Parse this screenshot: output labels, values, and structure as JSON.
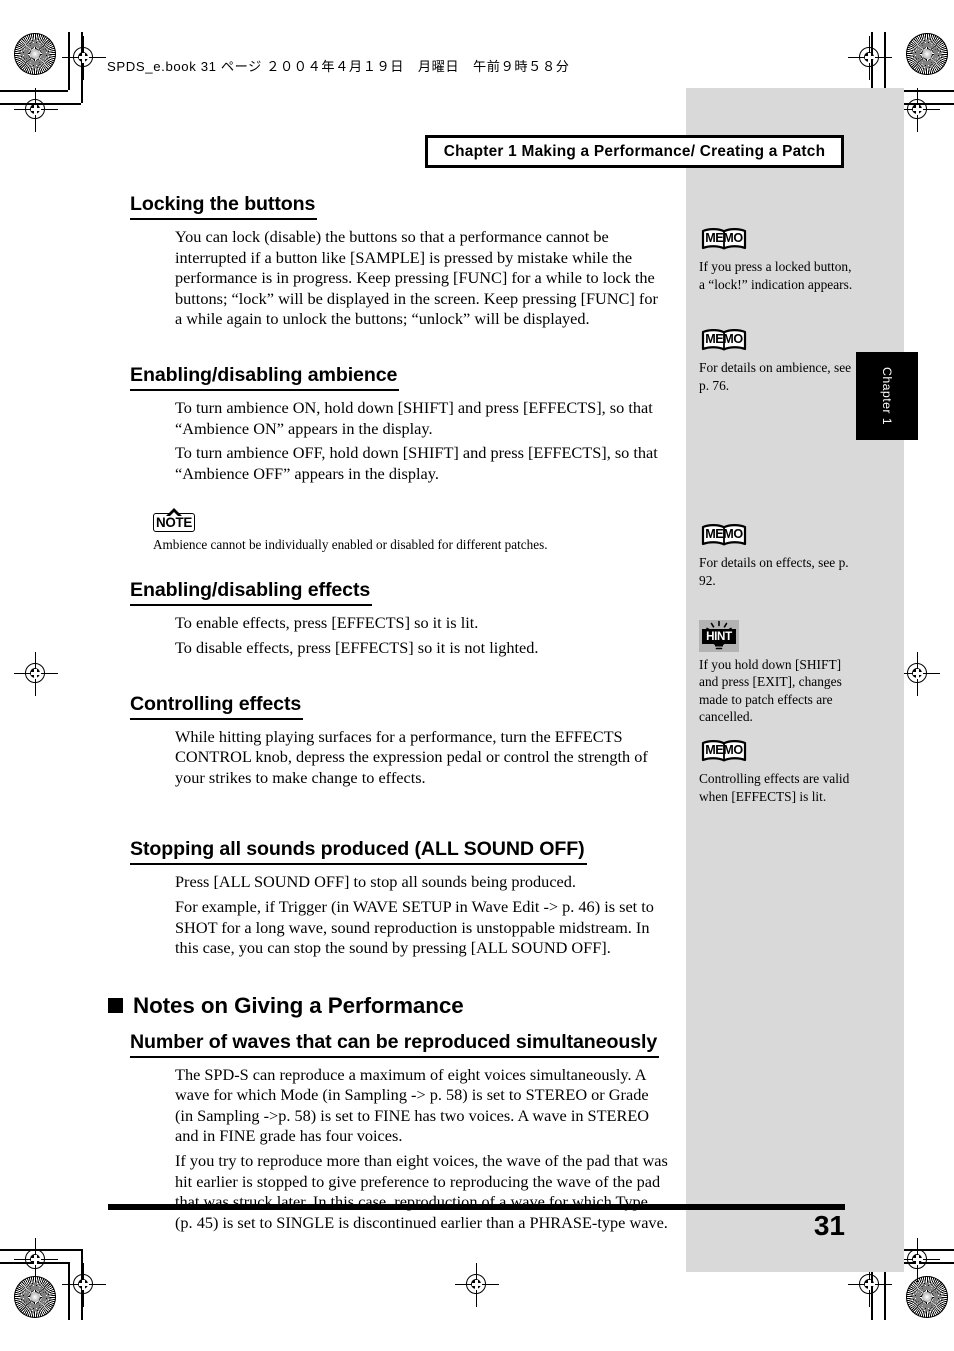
{
  "print_marks": {
    "slug": "SPDS_e.book  31 ページ  ２００４年４月１９日　月曜日　午前９時５８分"
  },
  "chapter_bar": {
    "title": "Chapter 1 Making a Performance/ Creating a Patch"
  },
  "chapter_tab": {
    "label": "Chapter 1"
  },
  "sections": [
    {
      "heading": "Locking the buttons",
      "paragraphs": [
        "You can lock (disable) the buttons so that a performance cannot be interrupted if a button like [SAMPLE] is pressed by mistake while the performance is in progress. Keep pressing [FUNC] for a while to lock the buttons; “lock” will be displayed in the screen. Keep pressing [FUNC] for a while again to unlock the buttons; “unlock” will be displayed."
      ]
    },
    {
      "heading": "Enabling/disabling ambience",
      "paragraphs": [
        "To turn ambience ON, hold down [SHIFT] and press [EFFECTS], so that “Ambience ON” appears in the display.",
        "To turn ambience OFF, hold down [SHIFT] and press [EFFECTS], so that “Ambience OFF” appears in the display."
      ]
    },
    {
      "heading": "Enabling/disabling effects",
      "paragraphs": [
        "To enable effects, press [EFFECTS] so it is lit.",
        "To disable effects, press [EFFECTS] so it is not lighted."
      ]
    },
    {
      "heading": "Controlling effects",
      "paragraphs": [
        "While hitting playing surfaces for a performance, turn the EFFECTS CONTROL knob, depress the expression pedal or control the strength of your strikes to make change to effects."
      ]
    },
    {
      "heading": "Stopping all sounds produced (ALL SOUND OFF)",
      "paragraphs": [
        "Press [ALL SOUND OFF] to stop all sounds being produced.",
        "For example, if Trigger (in WAVE SETUP in Wave Edit -> p. 46) is set to SHOT for a long wave, sound reproduction is unstoppable midstream. In this case, you can stop the sound by pressing [ALL SOUND OFF]."
      ]
    }
  ],
  "note_callout": {
    "icon_label": "NOTE",
    "text": "Ambience cannot be individually enabled or disabled for different patches."
  },
  "big_heading": {
    "text": "Notes on Giving a Performance"
  },
  "subsection": {
    "heading": "Number of waves that can be reproduced simultaneously",
    "paragraphs": [
      "The SPD-S can reproduce a maximum of eight voices simultaneously. A wave for which Mode (in Sampling -> p. 58) is set to STEREO or Grade (in Sampling ->p. 58) is set to FINE has two voices. A wave in STEREO and in FINE grade has four voices.",
      "If you try to reproduce more than eight voices, the wave of the pad that was hit earlier is stopped to give preference to reproducing the wave of the pad that was struck later. In this case, reproduction of a wave for which Type (p. 45) is set to SINGLE is discontinued earlier than a PHRASE-type wave."
    ]
  },
  "side_notes": [
    {
      "icon": "memo-icon",
      "icon_label": "MEMO",
      "text": "If you press a locked button, a “lock!” indication appears."
    },
    {
      "icon": "memo-icon",
      "icon_label": "MEMO",
      "text": "For details on ambience, see p. 76."
    },
    {
      "icon": "memo-icon",
      "icon_label": "MEMO",
      "text": "For details on effects, see p. 92."
    },
    {
      "icon": "hint-icon",
      "icon_label": "HINT",
      "text": "If you hold down [SHIFT] and press [EXIT], changes made to patch effects are cancelled."
    },
    {
      "icon": "memo-icon",
      "icon_label": "MEMO",
      "text": "Controlling effects are valid when [EFFECTS] is lit."
    }
  ],
  "footer": {
    "page_number": "31"
  },
  "colors": {
    "sidebar_gray": "#d9d9d9",
    "ink": "#000000",
    "paper": "#ffffff",
    "hint_box_gray": "#b3b3b3"
  }
}
